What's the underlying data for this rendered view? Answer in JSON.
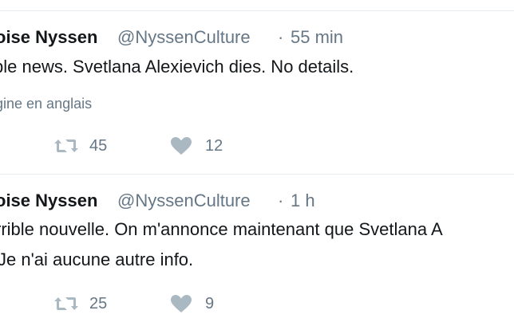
{
  "tweets": [
    {
      "fullname": "oise Nyssen",
      "username": "@NyssenCulture",
      "separator": "·",
      "time": "55 min",
      "text_lines": [
        "ble news. Svetlana Alexievich dies. No details."
      ],
      "translate": "gine en anglais",
      "retweets": "45",
      "likes": "12"
    },
    {
      "fullname": "oise Nyssen",
      "username": "@NyssenCulture",
      "separator": "·",
      "time": "1 h",
      "text_lines": [
        "rrible nouvelle. On m'annonce maintenant que Svetlana A",
        "Je n'ai aucune autre info."
      ],
      "retweets": "25",
      "likes": "9"
    }
  ],
  "colors": {
    "text": "#14171a",
    "secondary": "#657786",
    "divider": "#e6ecf0",
    "icon": "#aab8c2"
  },
  "icons": {
    "retweet": "retweet-icon",
    "like": "heart-icon"
  }
}
